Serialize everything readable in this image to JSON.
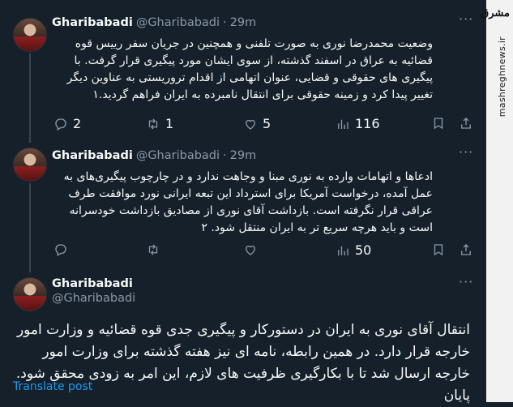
{
  "tweets": [
    {
      "name": "Gharibabadi",
      "handle": "@Gharibabadi",
      "time": "29m",
      "text": "وضعیت محمدرضا نوری به صورت تلفنی و همچنین در جریان سفر رییس قوه قضائیه به عراق در اسفند گذشته، از سوی ایشان مورد پیگیری قرار گرفت. با پیگیری های حقوقی و قضایی، عنوان اتهامی از اقدام تروریستی به عناوین دیگر تغییر پیدا کرد و زمینه حقوقی برای انتقال نامبرده به ایران فراهم گردید.۱",
      "replies": "2",
      "retweets": "1",
      "likes": "5",
      "views": "116"
    },
    {
      "name": "Gharibabadi",
      "handle": "@Gharibabadi",
      "time": "29m",
      "text": "ادعاها و اتهامات وارده به نوری مبنا و وجاهت ندارد و در چارچوب پیگیری‌های به عمل آمده، درخواست آمریکا برای استرداد این تبعه ایرانی نورد موافقت طرف عراقی قرار نگرفته است. بازداشت آقای نوری از مصادیق بازداشت خودسرانه است و باید هرچه سریع تر به ایران منتقل شود. ۲",
      "replies": "",
      "retweets": "",
      "likes": "",
      "views": "50"
    },
    {
      "name": "Gharibabadi",
      "handle": "@Gharibabadi",
      "text": "انتقال آقای نوری به ایران در دستورکار و پیگیری  جدی قوه قضائیه و وزارت امور خارجه قرار دارد. در همین رابطه، نامه ای نیز هفته گذشته برای وزارت امور خارجه ارسال شد تا با بکارگیری ظرفیت های لازم، این امر به زودی محقق شود. پایان",
      "translate": "Translate post"
    }
  ],
  "sidebar": {
    "logo": "مشرق",
    "site": "mashreghnews.ir"
  },
  "icons": [
    "reply-icon",
    "retweet-icon",
    "like-icon",
    "views-icon",
    "bookmark-icon",
    "share-icon",
    "more-icon"
  ]
}
